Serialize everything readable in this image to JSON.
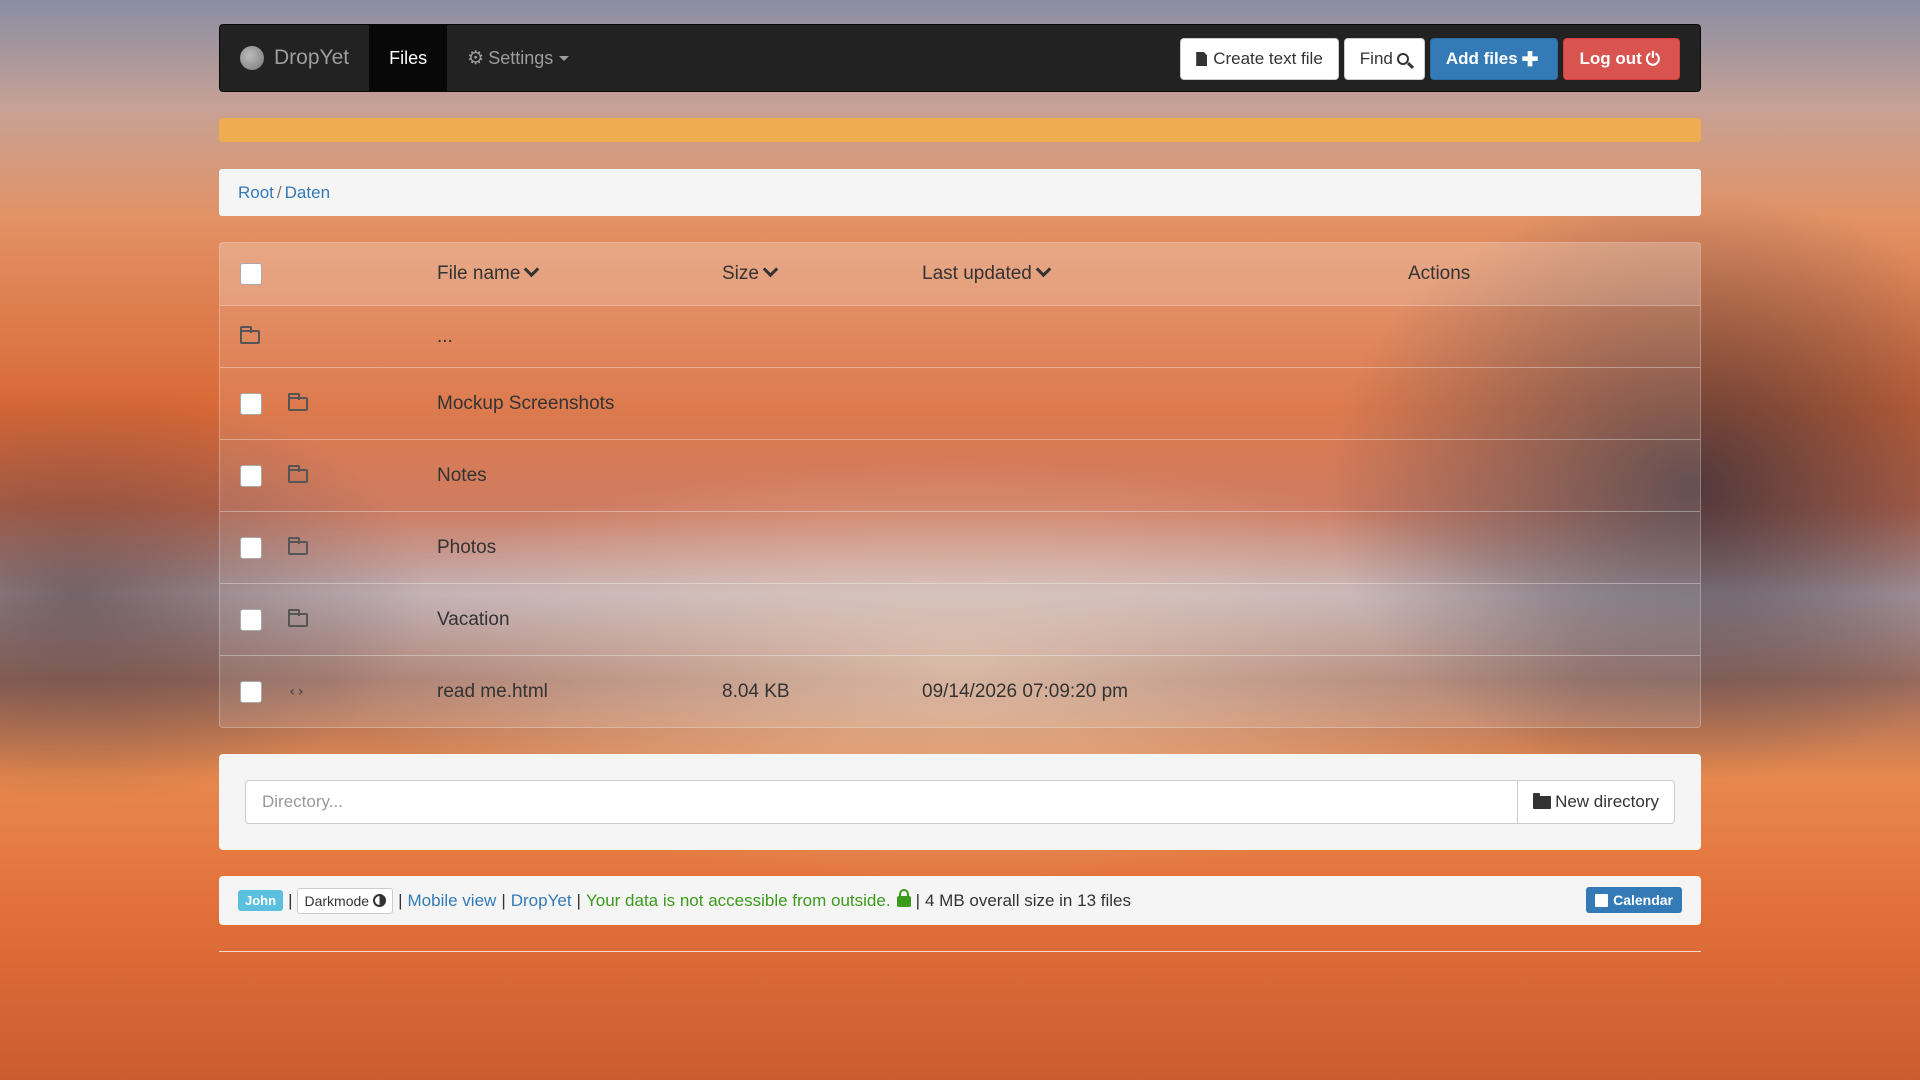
{
  "navbar": {
    "brand": "DropYet",
    "files_label": "Files",
    "settings_label": "Settings",
    "create_text_file_label": "Create text file",
    "find_label": "Find",
    "add_files_label": "Add files",
    "logout_label": "Log out"
  },
  "progress": {
    "percent": 100,
    "color": "#f0ad4e"
  },
  "breadcrumb": {
    "root": "Root",
    "separator": "/",
    "current": "Daten"
  },
  "table": {
    "headers": {
      "name": "File name",
      "size": "Size",
      "updated": "Last updated",
      "actions": "Actions"
    },
    "parent_label": "...",
    "rows": [
      {
        "type": "folder",
        "name": "Mockup Screenshots",
        "size": "",
        "updated": ""
      },
      {
        "type": "folder",
        "name": "Notes",
        "size": "",
        "updated": ""
      },
      {
        "type": "folder",
        "name": "Photos",
        "size": "",
        "updated": ""
      },
      {
        "type": "folder",
        "name": "Vacation",
        "size": "",
        "updated": ""
      },
      {
        "type": "file",
        "icon": "code-icon",
        "icon_glyph": "‹›",
        "name": "read me.html",
        "size": "8.04 KB",
        "updated": "09/14/2026 07:09:20 pm"
      }
    ]
  },
  "new_directory": {
    "placeholder": "Directory...",
    "button_label": "New directory"
  },
  "footer": {
    "user": "John",
    "darkmode_label": "Darkmode",
    "sep": "|",
    "mobile_view": "Mobile view",
    "dropyet_link": "DropYet",
    "security_text": "Your data is not accessible from outside.",
    "stats": "4 MB overall size in 13 files",
    "calendar_label": "Calendar"
  },
  "colors": {
    "primary": "#337ab7",
    "danger": "#d9534f",
    "warning": "#f0ad4e",
    "success": "#3c9a1c",
    "info": "#5bc0de"
  }
}
